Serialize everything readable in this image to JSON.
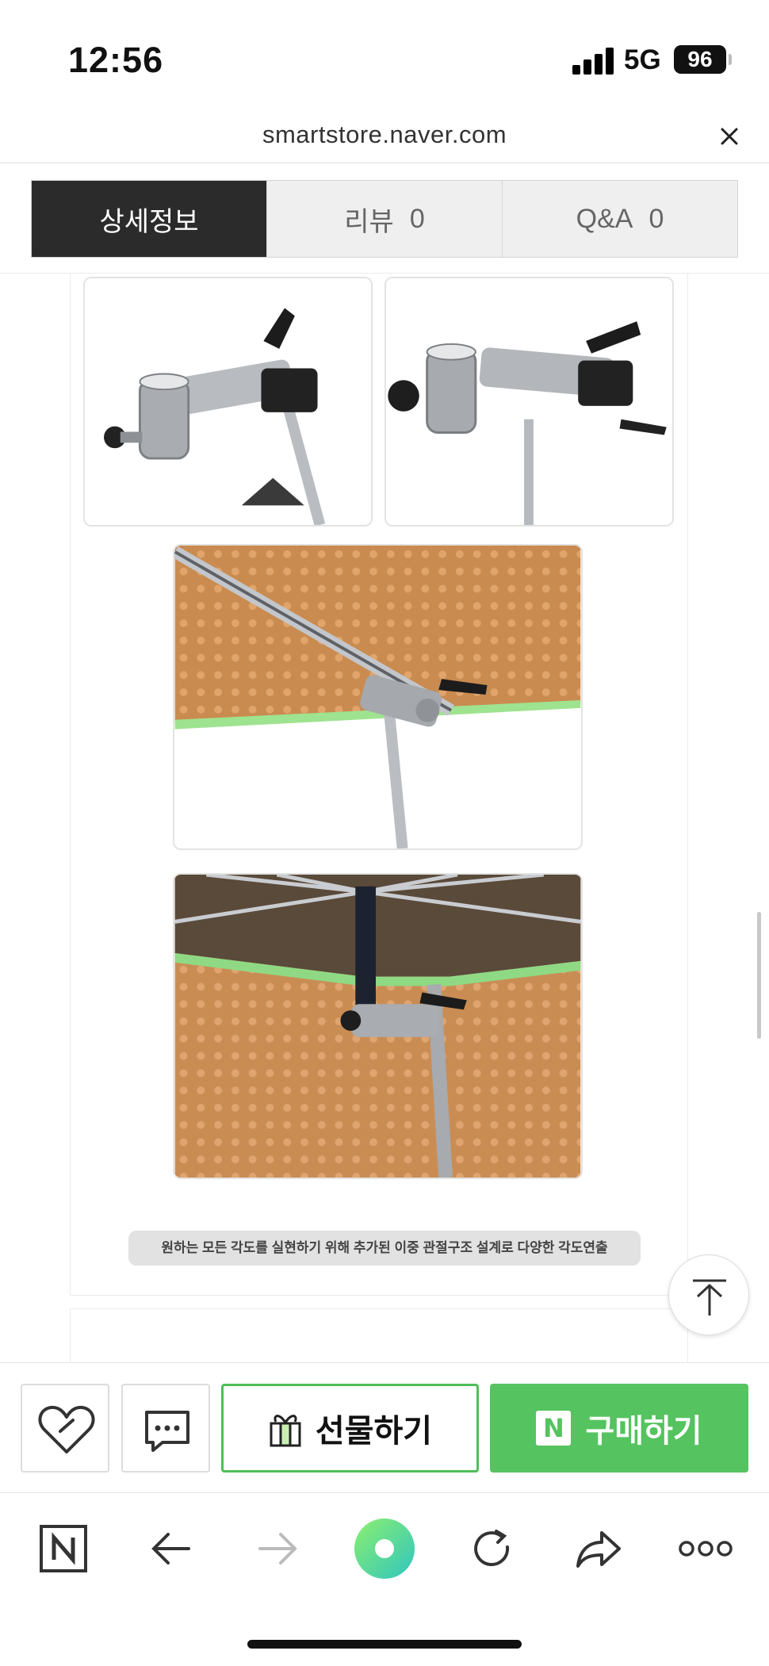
{
  "status": {
    "time": "12:56",
    "network": "5G",
    "battery": "96"
  },
  "browser": {
    "url": "smartstore.naver.com"
  },
  "tabs": [
    {
      "label": "상세정보",
      "count": ""
    },
    {
      "label": "리뷰",
      "count": "0"
    },
    {
      "label": "Q&A",
      "count": "0"
    }
  ],
  "content": {
    "caption": "원하는 모든 각도를 실현하기 위해 추가된 이중 관절구조 설계로 다양한 각도연출"
  },
  "purchase": {
    "gift_label": "선물하기",
    "buy_label": "구매하기",
    "buy_badge": "N"
  },
  "colors": {
    "accent_green": "#55c35f",
    "tab_active": "#2b2b2b"
  },
  "icons": {
    "close": "close-icon",
    "zzim": "heart-icon",
    "talk": "chat-icon",
    "gift": "gift-icon",
    "top": "arrow-up-icon",
    "naver": "naver-home-icon",
    "back": "arrow-left-icon",
    "forward": "arrow-right-icon",
    "green_dot": "green-dot-icon",
    "reload": "reload-icon",
    "share": "share-icon",
    "more": "more-icon"
  }
}
